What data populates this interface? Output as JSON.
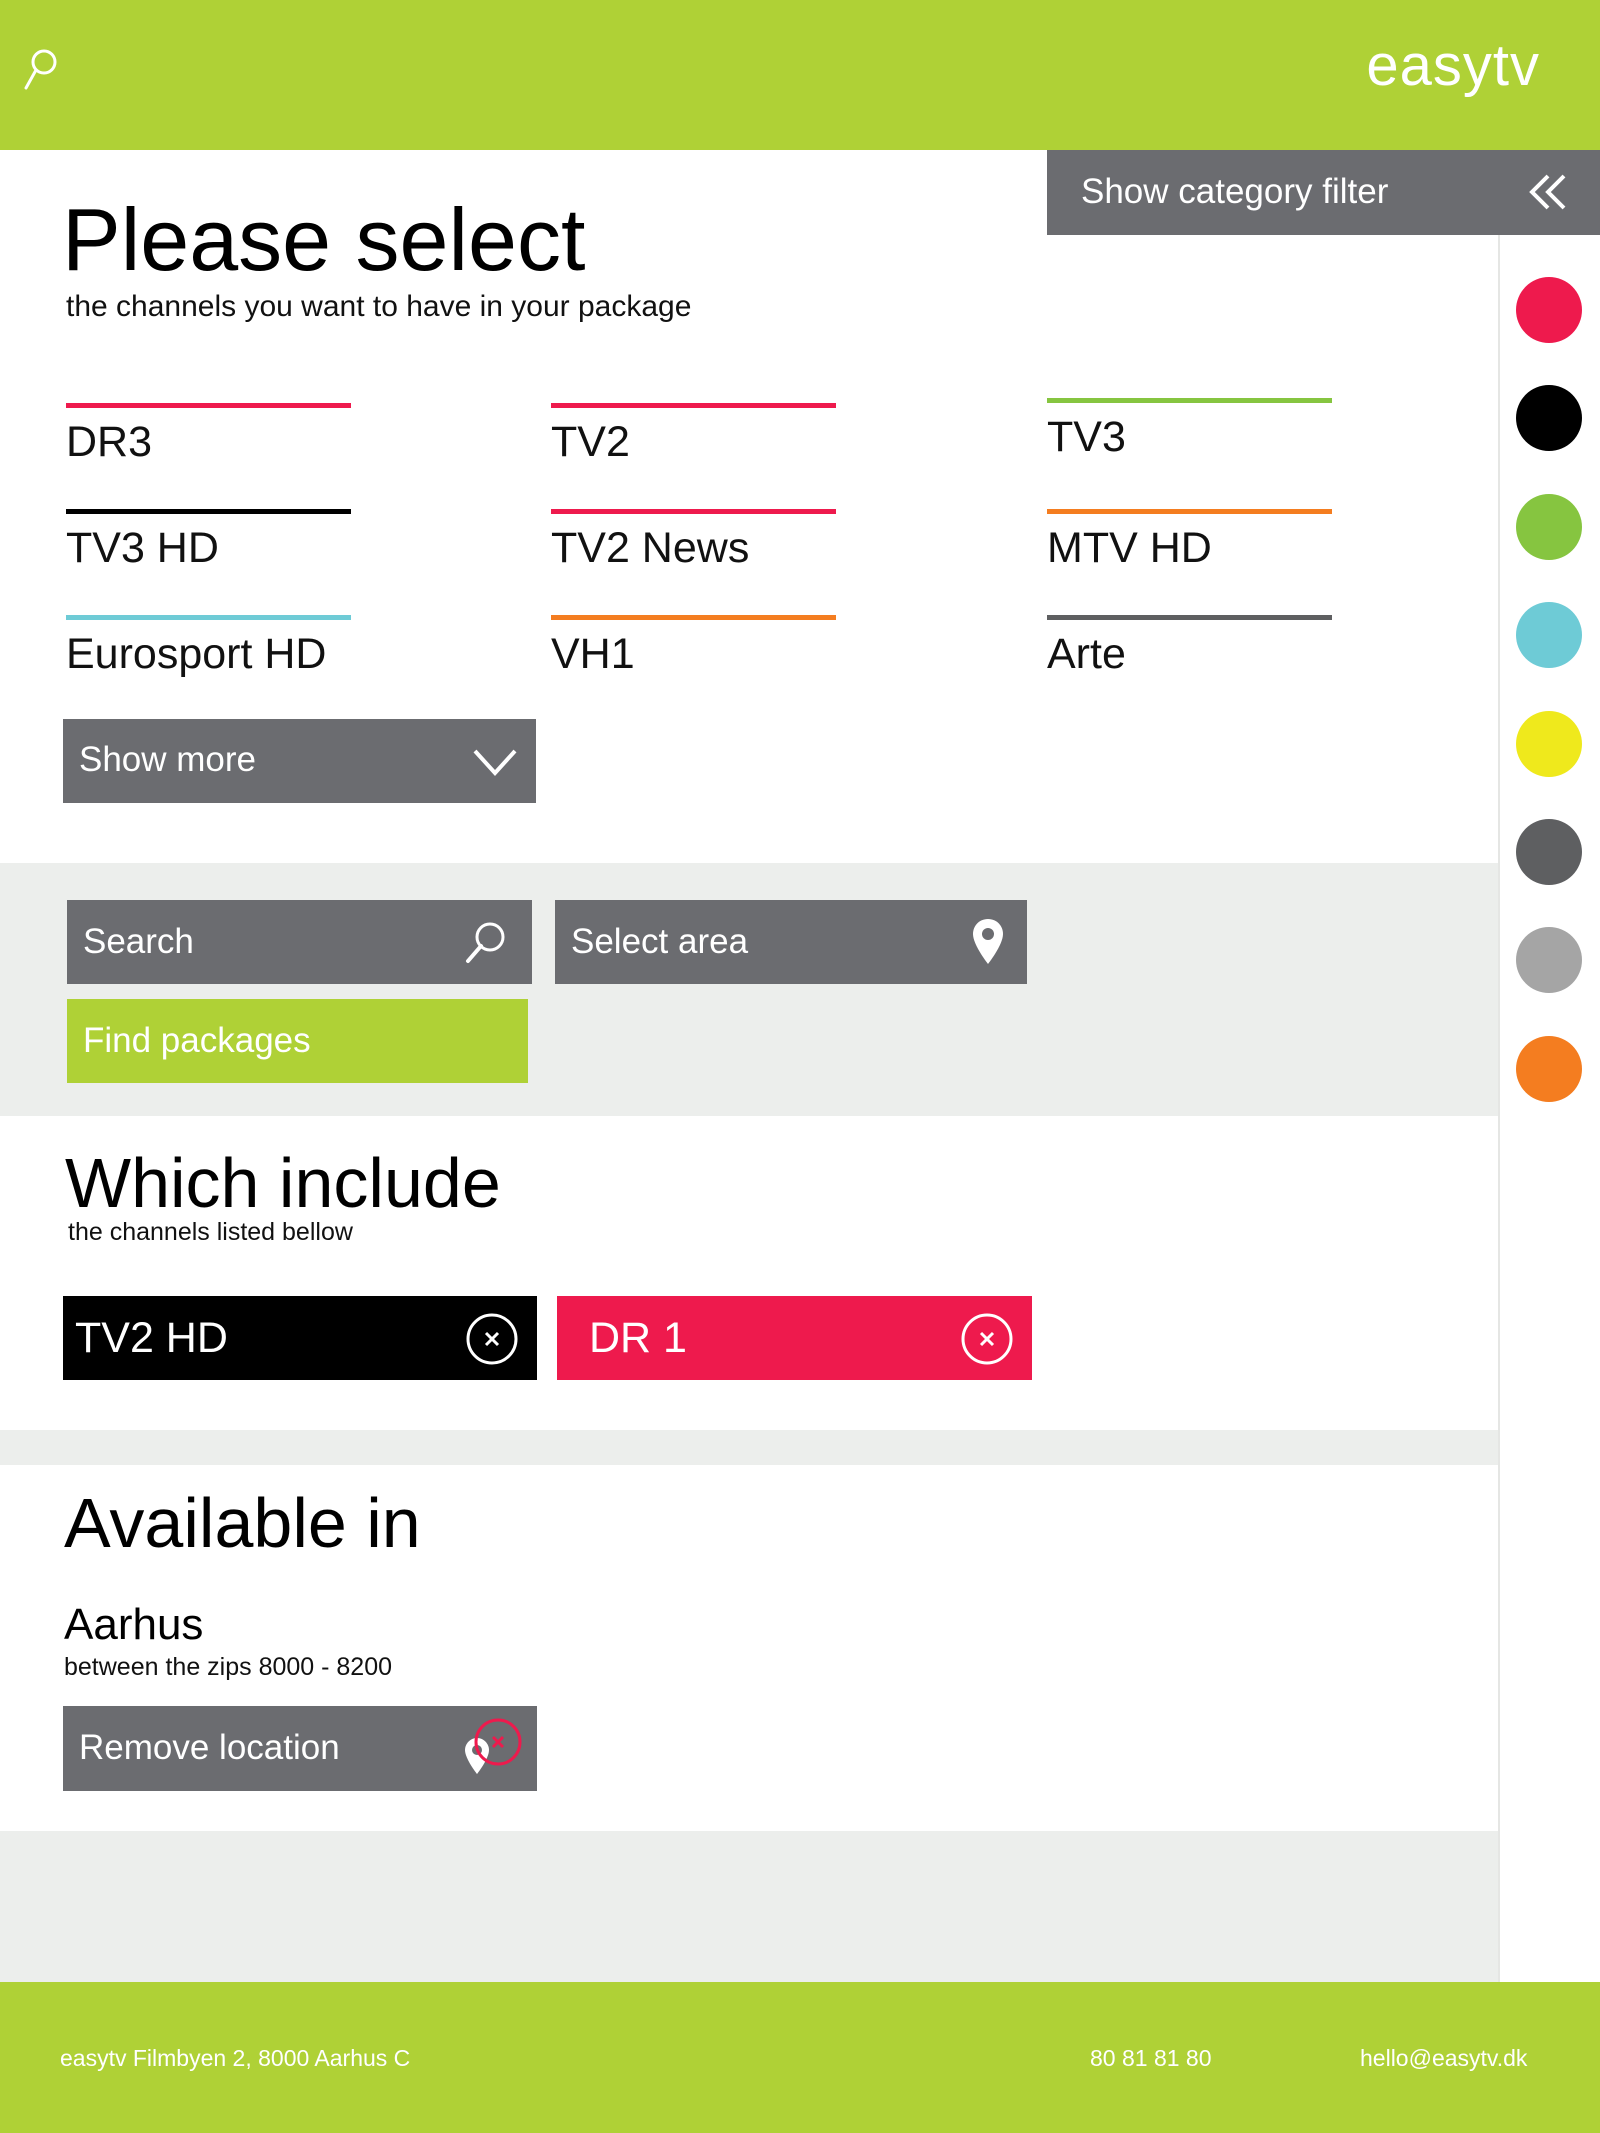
{
  "header": {
    "brand": "easytv",
    "search_icon": "search-icon"
  },
  "category_filter": {
    "label": "Show category filter",
    "icon": "double-chevron-left-icon",
    "colors": [
      "#ee1a4d",
      "#000000",
      "#86c540",
      "#6ecbd6",
      "#efe91c",
      "#5e5f61",
      "#a5a5a5",
      "#f47d20"
    ]
  },
  "select_section": {
    "title": "Please select",
    "subtitle": "the channels you want to have in your package",
    "channels": [
      {
        "name": "DR3",
        "color": "#ee1a4d"
      },
      {
        "name": "TV2",
        "color": "#ee1a4d"
      },
      {
        "name": "TV3",
        "color": "#86c540"
      },
      {
        "name": "TV3 HD",
        "color": "#000000"
      },
      {
        "name": "TV2 News",
        "color": "#ee1a4d"
      },
      {
        "name": "MTV HD",
        "color": "#f47d20"
      },
      {
        "name": "Eurosport HD",
        "color": "#6ecbd6"
      },
      {
        "name": "VH1",
        "color": "#f47d20"
      },
      {
        "name": "Arte",
        "color": "#5e5f61"
      }
    ],
    "show_more": "Show more"
  },
  "search_bar": {
    "search_label": "Search",
    "area_label": "Select area",
    "find_label": "Find packages"
  },
  "include_section": {
    "title": "Which include",
    "subtitle": "the channels listed bellow",
    "tags": [
      {
        "name": "TV2 HD",
        "color": "#000000"
      },
      {
        "name": "DR 1",
        "color": "#ee1a4d"
      }
    ]
  },
  "available_section": {
    "title": "Available in",
    "city": "Aarhus",
    "zips": "between the zips 8000 - 8200",
    "remove_label": "Remove location"
  },
  "footer": {
    "address": "easytv  Filmbyen 2, 8000 Aarhus C",
    "phone": "80 81 81 80",
    "email": "hello@easytv.dk"
  },
  "accent_colors": {
    "brand_green": "#afd136",
    "button_gray": "#6b6c70",
    "band_gray": "#eceeec",
    "red": "#ee1a4d"
  }
}
